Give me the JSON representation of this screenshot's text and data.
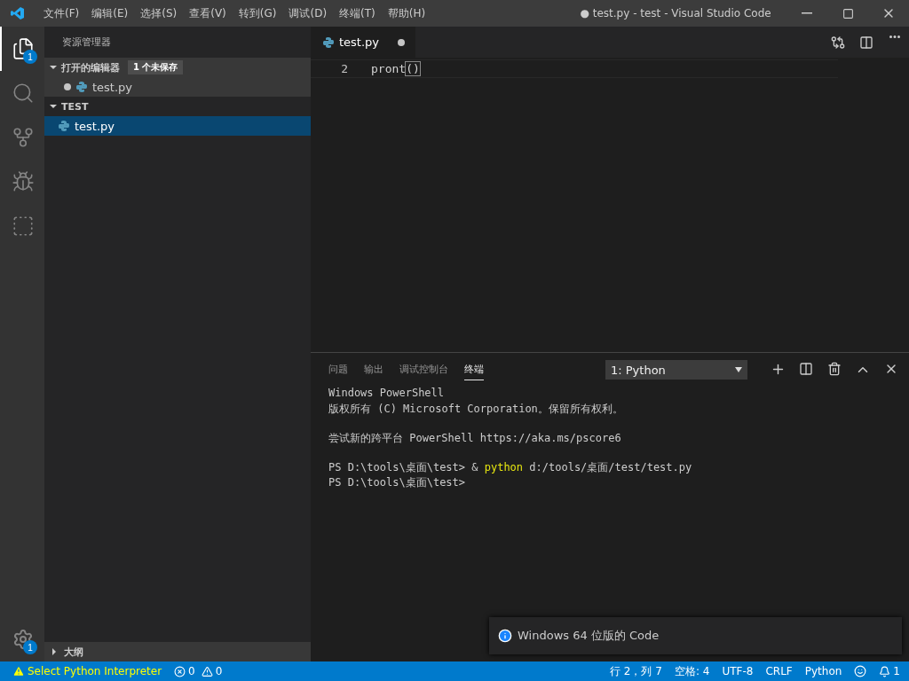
{
  "window": {
    "title": "● test.py - test - Visual Studio Code"
  },
  "menu": [
    "文件(F)",
    "编辑(E)",
    "选择(S)",
    "查看(V)",
    "转到(G)",
    "调试(D)",
    "终端(T)",
    "帮助(H)"
  ],
  "activity_bar": [
    {
      "kind": "explorer",
      "selected": true,
      "badge": "1"
    },
    {
      "kind": "search",
      "selected": false
    },
    {
      "kind": "scm",
      "selected": false
    },
    {
      "kind": "debug",
      "selected": false
    },
    {
      "kind": "extensions",
      "selected": false
    }
  ],
  "settings_badge": "1",
  "sidebar": {
    "title": "资源管理器",
    "sections": [
      {
        "title": "打开的编辑器",
        "badge": "1 个未保存",
        "expanded": true,
        "items": [
          {
            "label": "test.py",
            "modified": true,
            "selected": false
          }
        ]
      },
      {
        "title": "TEST",
        "expanded": true,
        "items": [
          {
            "label": "test.py",
            "modified": false,
            "selected": true
          }
        ]
      }
    ],
    "outline": {
      "title": "大纲",
      "expanded": false
    }
  },
  "editor": {
    "tabs": [
      {
        "label": "test.py",
        "modified": true,
        "selected": true
      }
    ],
    "lines": [
      {
        "number": "2",
        "code": "pront",
        "bracket": "()"
      }
    ]
  },
  "panel": {
    "tabs": [
      {
        "label": "问题",
        "selected": false
      },
      {
        "label": "输出",
        "selected": false
      },
      {
        "label": "调试控制台",
        "selected": false
      },
      {
        "label": "终端",
        "selected": true
      }
    ],
    "terminal_select": "1: Python",
    "terminal": [
      [
        [
          {
            "text": "Windows PowerShell",
            "kind": "plain"
          }
        ],
        [
          {
            "text": "版权所有 (C) Microsoft Corporation。保留所有权利。",
            "kind": "plain"
          }
        ]
      ],
      [
        [
          {
            "text": "尝试新的跨平台 PowerShell https://aka.ms/pscore6",
            "kind": "plain"
          }
        ]
      ],
      [
        [
          {
            "text": "PS D:\\tools\\桌面\\test> & ",
            "kind": "plain"
          },
          {
            "text": "python",
            "kind": "command"
          },
          {
            "text": " d:/tools/桌面/test/test.py",
            "kind": "plain"
          }
        ],
        [
          {
            "text": "PS D:\\tools\\桌面\\test>",
            "kind": "plain"
          }
        ]
      ]
    ]
  },
  "notification": {
    "text": "Windows 64 位版的 Code"
  },
  "status_bar": {
    "interpreter": "Select Python Interpreter",
    "errors": "0",
    "warnings": "0",
    "items": [
      "行 2，列 7",
      "空格: 4",
      "UTF-8",
      "CRLF",
      "Python"
    ],
    "notifications": "1"
  }
}
